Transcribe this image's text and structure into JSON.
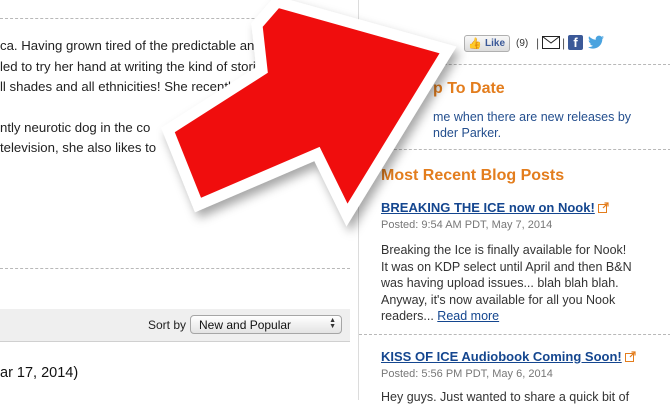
{
  "bio": {
    "lines_p1": [
      "ca. Having grown tired of the predictable an",
      "led to try her hand at writing the kind of storie",
      "ll shades and all ethnicities! She recently"
    ],
    "lines_p2": [
      "ntly neurotic dog in the co",
      " television, she also likes to"
    ]
  },
  "sortbar": {
    "label": "Sort by",
    "selected": "New and Popular"
  },
  "review": {
    "date": "ar 17, 2014)"
  },
  "social": {
    "like_label": "Like",
    "like_count": "(9)",
    "separator": "|"
  },
  "stay_up": {
    "heading": "p To Date",
    "line1": "me when there are new releases by",
    "line2": "nder Parker."
  },
  "blog": {
    "heading": "Most Recent Blog Posts",
    "posts": [
      {
        "title": "BREAKING THE ICE now on Nook!",
        "meta": "Posted: 9:54 AM PDT, May 7, 2014",
        "body": [
          "Breaking the Ice is finally available for Nook!",
          "It was on KDP select until April and then B&N",
          "was having upload issues... blah blah blah.",
          "Anyway, it's now available for all you Nook"
        ],
        "last_line": "readers...",
        "read_more": "Read more"
      },
      {
        "title": "KISS OF ICE Audiobook Coming Soon!",
        "meta": "Posted: 5:56 PM PDT, May 6, 2014",
        "body_partial": "Hey guys. Just wanted to share a quick bit of"
      }
    ]
  },
  "colors": {
    "heading_orange": "#e37d1d",
    "link_blue": "#14468f",
    "arrow_red": "#f01010"
  },
  "icons": [
    "like-thumb-icon",
    "mail-icon",
    "facebook-icon",
    "twitter-icon",
    "external-link-icon",
    "select-arrows-icon",
    "red-arrow-graphic"
  ]
}
